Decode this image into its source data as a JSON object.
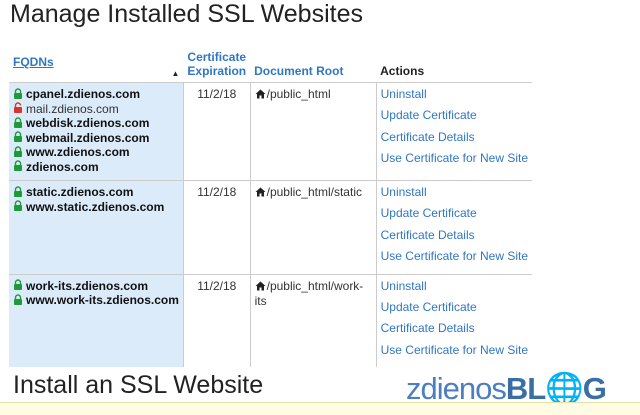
{
  "page": {
    "title": "Manage Installed SSL Websites",
    "install_title": "Install an SSL Website"
  },
  "table": {
    "headers": {
      "fqdns": "FQDNs",
      "sort_indicator": "▲",
      "expiration_line1": "Certificate",
      "expiration_line2": "Expiration",
      "docroot": "Document Root",
      "actions": "Actions"
    },
    "rows": [
      {
        "domains": [
          {
            "name": "cpanel.zdienos.com",
            "secure": true
          },
          {
            "name": "mail.zdienos.com",
            "secure": false
          },
          {
            "name": "webdisk.zdienos.com",
            "secure": true
          },
          {
            "name": "webmail.zdienos.com",
            "secure": true
          },
          {
            "name": "www.zdienos.com",
            "secure": true
          },
          {
            "name": "zdienos.com",
            "secure": true
          }
        ],
        "expiration": "11/2/18",
        "docroot": "/public_html",
        "actions": [
          "Uninstall",
          "Update Certificate",
          "Certificate Details",
          "Use Certificate for New Site"
        ]
      },
      {
        "domains": [
          {
            "name": "static.zdienos.com",
            "secure": true
          },
          {
            "name": "www.static.zdienos.com",
            "secure": true
          }
        ],
        "expiration": "11/2/18",
        "docroot": "/public_html/static",
        "actions": [
          "Uninstall",
          "Update Certificate",
          "Certificate Details",
          "Use Certificate for New Site"
        ]
      },
      {
        "domains": [
          {
            "name": "work-its.zdienos.com",
            "secure": true
          },
          {
            "name": "www.work-its.zdienos.com",
            "secure": true
          }
        ],
        "expiration": "11/2/18",
        "docroot": "/public_html/work-its",
        "actions": [
          "Uninstall",
          "Update Certificate",
          "Certificate Details",
          "Use Certificate for New Site"
        ]
      }
    ]
  },
  "watermark": {
    "part1": "zdienos",
    "part2": "BL",
    "part3": "G"
  },
  "colors": {
    "link": "#2f77c3",
    "secure_lock": "#1e9a3a",
    "insecure_lock": "#d9342b",
    "fqdn_bg": "#dcebfa"
  }
}
